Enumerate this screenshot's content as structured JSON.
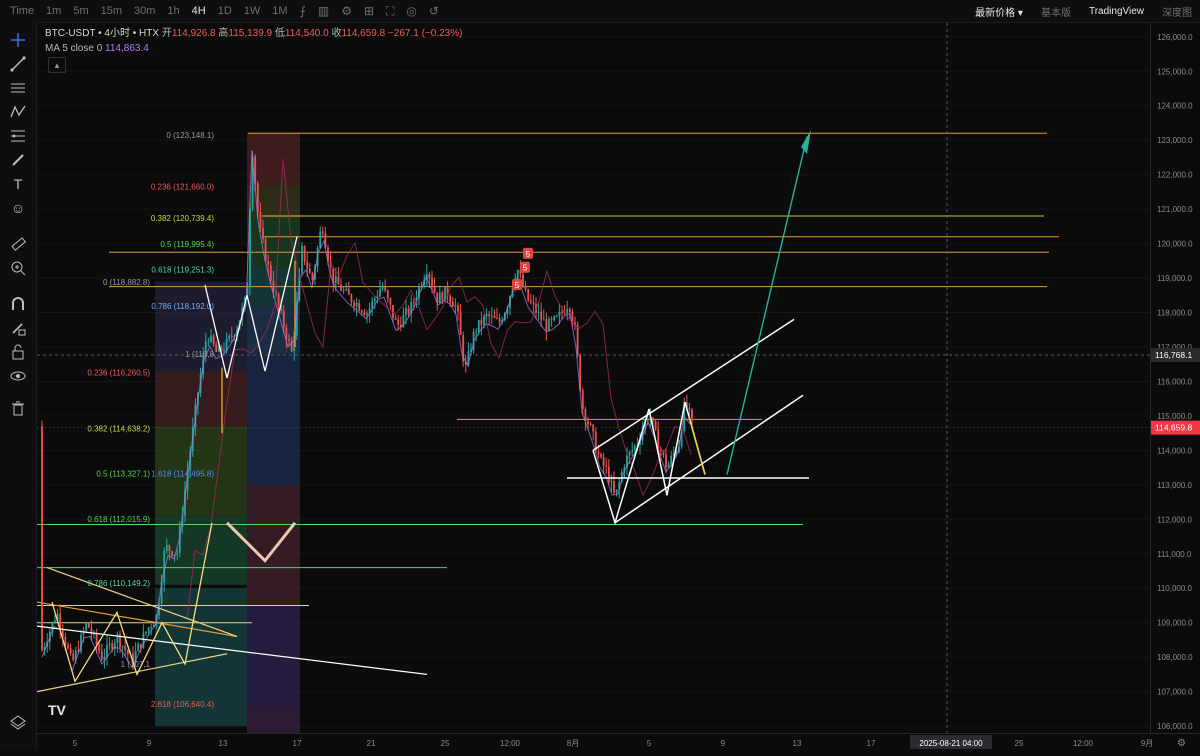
{
  "topbar": {
    "timeframes": [
      {
        "label": "Time",
        "active": false
      },
      {
        "label": "1m",
        "active": false
      },
      {
        "label": "5m",
        "active": false
      },
      {
        "label": "15m",
        "active": false
      },
      {
        "label": "30m",
        "active": false
      },
      {
        "label": "1h",
        "active": false
      },
      {
        "label": "4H",
        "active": true
      },
      {
        "label": "1D",
        "active": false
      },
      {
        "label": "1W",
        "active": false
      },
      {
        "label": "1M",
        "active": false
      }
    ],
    "price_source": "最新价格 ▾",
    "basic_label": "基本版",
    "tradingview_label": "TradingView",
    "depth_label": "深度图"
  },
  "legend": {
    "symbol": "BTC-USDT • 4小时 • HTX",
    "open_label": "开",
    "open": "114,926.8",
    "high_label": "高",
    "high": "115,139.9",
    "low_label": "低",
    "low": "114,540.0",
    "close_label": "收",
    "close": "114,659.8",
    "change": "−267.1 (−0.23%)",
    "ma_label": "MA 5 close 0",
    "ma_value": "114,863.4"
  },
  "chart_data": {
    "type": "candlestick",
    "y_range": [
      105800,
      126400
    ],
    "y_ticks": [
      126000,
      125000,
      124000,
      123000,
      122000,
      121000,
      120000,
      119000,
      118000,
      117000,
      116000,
      115000,
      114000,
      113000,
      112000,
      111000,
      110000,
      109000,
      108000,
      107000,
      106000
    ],
    "y_tick_labels": [
      "126,000.0",
      "125,000.0",
      "124,000.0",
      "123,000.0",
      "122,000.0",
      "121,000.0",
      "120,000.0",
      "119,000.0",
      "118,000.0",
      "117,000.0",
      "116,000.0",
      "115,000.0",
      "114,000.0",
      "113,000.0",
      "112,000.0",
      "111,000.0",
      "110,000.0",
      "109,000.0",
      "108,000.0",
      "107,000.0",
      "106,000.0"
    ],
    "x_ticks": [
      "5",
      "9",
      "13",
      "17",
      "21",
      "25",
      "12:00",
      "8月",
      "5",
      "9",
      "13",
      "17",
      "21",
      "25",
      "12:00",
      "9月"
    ],
    "crosshair_price": "116,768.1",
    "crosshair_time": "2025-08-21  04:00",
    "last_price": "114,659.8",
    "last_price_color": "#f23645",
    "fib_labels_upper": [
      {
        "label": "0 (123,148.1)",
        "color": "#9a9a9a"
      },
      {
        "label": "0.236 (121,660.0)",
        "color": "#f05a5a"
      },
      {
        "label": "0.382 (120,739.4)",
        "color": "#c6d94a"
      },
      {
        "label": "0.5 (119,995.4)",
        "color": "#5ad35a"
      },
      {
        "label": "0.618 (119,251.3)",
        "color": "#5ad3a0"
      },
      {
        "label": "0.786 (118,192.0)",
        "color": "#6fb0f0"
      },
      {
        "label": "1 (116,8",
        "color": "#9a9a9a"
      }
    ],
    "fib_labels_lower": [
      {
        "label": "0 (118,882.8)",
        "color": "#9a9a9a"
      },
      {
        "label": "0.236 (116,260.5)",
        "color": "#f05a5a"
      },
      {
        "label": "0.382 (114,638.2)",
        "color": "#c6d94a"
      },
      {
        "label": "0.5 (113,327.1)",
        "color": "#5ad35a"
      },
      {
        "label": "0.618 (112,015.9)",
        "color": "#5ad35a"
      },
      {
        "label": "0.786 (110,149.2)",
        "color": "#5ad3a0"
      },
      {
        "label": "1.618 (114,495.8)",
        "color": "#5a8cf0"
      },
      {
        "label": "1 (107,1",
        "color": "#9a9a9a"
      },
      {
        "label": "2.618 (106,640.4)",
        "color": "#f05a5a"
      }
    ],
    "markers": [
      "5",
      "5",
      "5"
    ],
    "colors": {
      "up": "#26a69a",
      "down": "#ef5350",
      "accent_arrow": "#22b59a"
    }
  },
  "branding": {
    "logo": "TV"
  }
}
